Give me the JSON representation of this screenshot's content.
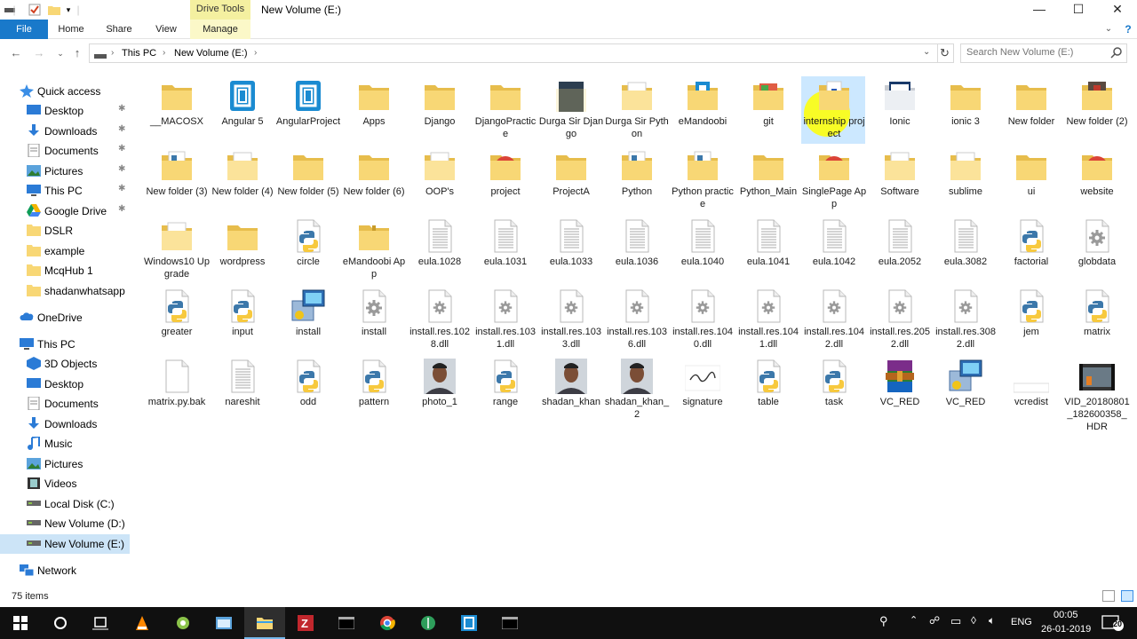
{
  "window": {
    "title": "New Volume (E:)",
    "context_tab": "Drive Tools",
    "minimize": "—",
    "maximize": "☐",
    "close": "✕"
  },
  "ribbon": {
    "tabs": [
      "File",
      "Home",
      "Share",
      "View",
      "Manage"
    ]
  },
  "address": {
    "crumbs": [
      "This PC",
      "New Volume (E:)"
    ],
    "search_placeholder": "Search New Volume (E:)"
  },
  "nav": {
    "quick_access": "Quick access",
    "pinned": [
      "Desktop",
      "Downloads",
      "Documents",
      "Pictures",
      "This PC",
      "Google Drive"
    ],
    "recent": [
      "DSLR",
      "example",
      "McqHub 1",
      "shadanwhatsapp"
    ],
    "onedrive": "OneDrive",
    "this_pc": "This PC",
    "pc_items": [
      "3D Objects",
      "Desktop",
      "Documents",
      "Downloads",
      "Music",
      "Pictures",
      "Videos",
      "Local Disk (C:)",
      "New Volume (D:)",
      "New Volume (E:)"
    ],
    "network": "Network"
  },
  "items": [
    {
      "name": "__MACOSX",
      "icon": "folder"
    },
    {
      "name": "Angular 5",
      "icon": "bracket-app"
    },
    {
      "name": "AngularProject",
      "icon": "bracket-app"
    },
    {
      "name": "Apps",
      "icon": "folder"
    },
    {
      "name": "Django",
      "icon": "folder"
    },
    {
      "name": "DjangoPractice",
      "icon": "folder"
    },
    {
      "name": "Durga Sir Django",
      "icon": "folder-dark"
    },
    {
      "name": "Durga Sir Python",
      "icon": "folder-docs"
    },
    {
      "name": "eMandoobi",
      "icon": "folder-app"
    },
    {
      "name": "git",
      "icon": "folder-git"
    },
    {
      "name": "internship project",
      "icon": "folder-lock"
    },
    {
      "name": "Ionic",
      "icon": "folder-web"
    },
    {
      "name": "ionic 3",
      "icon": "folder"
    },
    {
      "name": "New folder",
      "icon": "folder"
    },
    {
      "name": "New folder (2)",
      "icon": "folder-photo"
    },
    {
      "name": "New folder (3)",
      "icon": "folder-py"
    },
    {
      "name": "New folder (4)",
      "icon": "folder-docs"
    },
    {
      "name": "New folder (5)",
      "icon": "folder"
    },
    {
      "name": "New folder (6)",
      "icon": "folder"
    },
    {
      "name": "OOP's",
      "icon": "folder-docs"
    },
    {
      "name": "project",
      "icon": "chrome"
    },
    {
      "name": "ProjectA",
      "icon": "folder"
    },
    {
      "name": "Python",
      "icon": "folder-py"
    },
    {
      "name": "Python practice",
      "icon": "folder-py"
    },
    {
      "name": "Python_Main",
      "icon": "folder"
    },
    {
      "name": "SinglePage App",
      "icon": "chrome"
    },
    {
      "name": "Software",
      "icon": "folder-docs"
    },
    {
      "name": "sublime",
      "icon": "folder-docs"
    },
    {
      "name": "ui",
      "icon": "folder"
    },
    {
      "name": "website",
      "icon": "chrome"
    },
    {
      "name": "Windows10 Upgrade",
      "icon": "folder-docs"
    },
    {
      "name": "wordpress",
      "icon": "folder"
    },
    {
      "name": "circle",
      "icon": "py-file"
    },
    {
      "name": "eMandoobi App",
      "icon": "zip-folder"
    },
    {
      "name": "eula.1028",
      "icon": "text-file"
    },
    {
      "name": "eula.1031",
      "icon": "text-file"
    },
    {
      "name": "eula.1033",
      "icon": "text-file"
    },
    {
      "name": "eula.1036",
      "icon": "text-file"
    },
    {
      "name": "eula.1040",
      "icon": "text-file"
    },
    {
      "name": "eula.1041",
      "icon": "text-file"
    },
    {
      "name": "eula.1042",
      "icon": "text-file"
    },
    {
      "name": "eula.2052",
      "icon": "text-file"
    },
    {
      "name": "eula.3082",
      "icon": "text-file"
    },
    {
      "name": "factorial",
      "icon": "py-file"
    },
    {
      "name": "globdata",
      "icon": "gear-file"
    },
    {
      "name": "greater",
      "icon": "py-file"
    },
    {
      "name": "input",
      "icon": "py-file"
    },
    {
      "name": "install",
      "icon": "installer"
    },
    {
      "name": "install",
      "icon": "gear-file"
    },
    {
      "name": "install.res.1028.dll",
      "icon": "dll-file"
    },
    {
      "name": "install.res.1031.dll",
      "icon": "dll-file"
    },
    {
      "name": "install.res.1033.dll",
      "icon": "dll-file"
    },
    {
      "name": "install.res.1036.dll",
      "icon": "dll-file"
    },
    {
      "name": "install.res.1040.dll",
      "icon": "dll-file"
    },
    {
      "name": "install.res.1041.dll",
      "icon": "dll-file"
    },
    {
      "name": "install.res.1042.dll",
      "icon": "dll-file"
    },
    {
      "name": "install.res.2052.dll",
      "icon": "dll-file"
    },
    {
      "name": "install.res.3082.dll",
      "icon": "dll-file"
    },
    {
      "name": "jem",
      "icon": "py-file"
    },
    {
      "name": "matrix",
      "icon": "py-file"
    },
    {
      "name": "matrix.py.bak",
      "icon": "blank-file"
    },
    {
      "name": "nareshit",
      "icon": "text-file"
    },
    {
      "name": "odd",
      "icon": "py-file"
    },
    {
      "name": "pattern",
      "icon": "py-file"
    },
    {
      "name": "photo_1",
      "icon": "photo"
    },
    {
      "name": "range",
      "icon": "py-file"
    },
    {
      "name": "shadan_khan",
      "icon": "photo"
    },
    {
      "name": "shadan_khan_2",
      "icon": "photo"
    },
    {
      "name": "signature",
      "icon": "signature"
    },
    {
      "name": "table",
      "icon": "py-file"
    },
    {
      "name": "task",
      "icon": "py-file"
    },
    {
      "name": "VC_RED",
      "icon": "winrar"
    },
    {
      "name": "VC_RED",
      "icon": "installer"
    },
    {
      "name": "vcredist",
      "icon": "blank-thin"
    },
    {
      "name": "VID_20180801_182600358_HDR",
      "icon": "video"
    }
  ],
  "status": {
    "count": "75 items"
  },
  "taskbar": {
    "lang": "ENG",
    "time": "00:05",
    "date": "26-01-2019",
    "notifications": "20"
  },
  "colors": {
    "folder": "#f8d775",
    "accent": "#1979ca",
    "selection": "#cce8ff",
    "taskbar": "#101010"
  }
}
